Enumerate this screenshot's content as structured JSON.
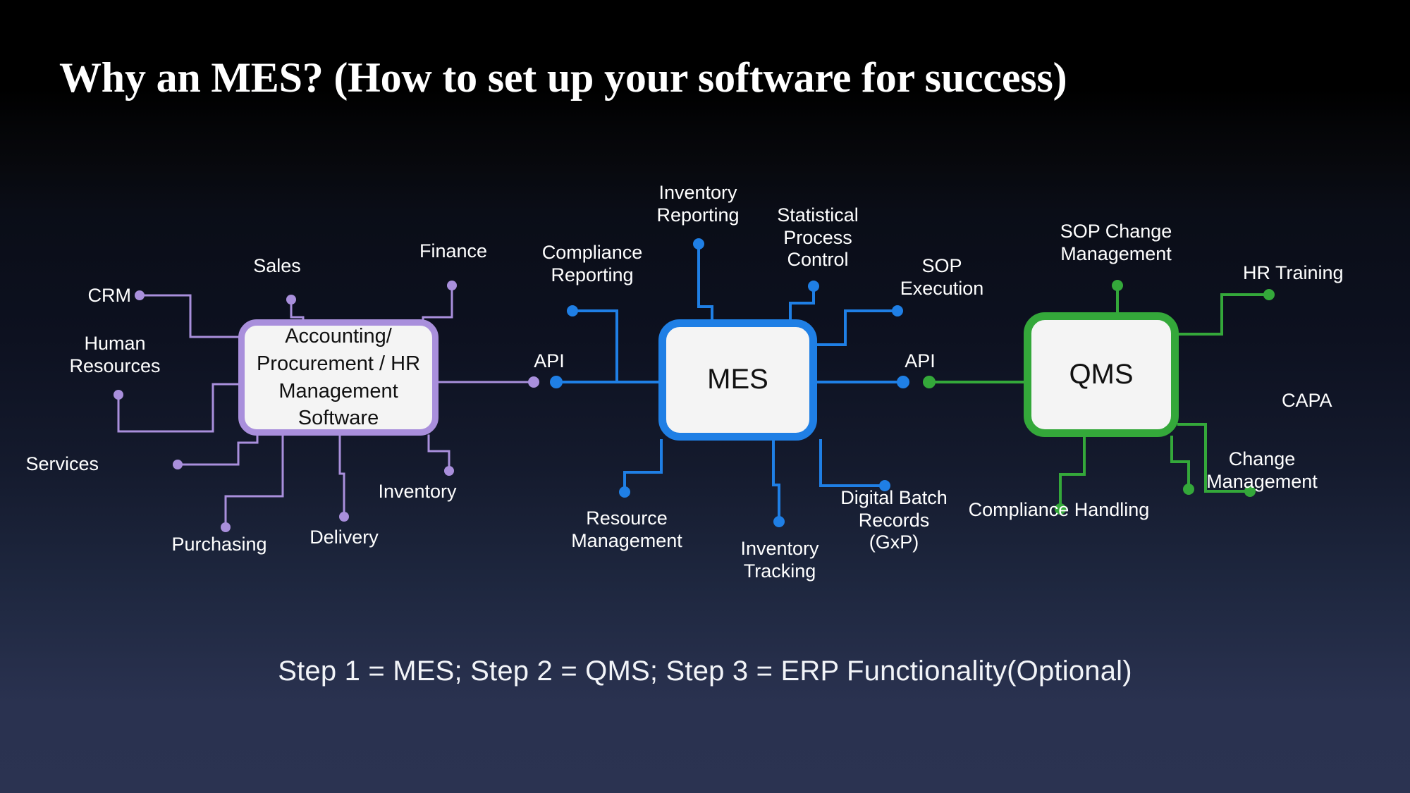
{
  "slide": {
    "title": "Why an MES? (How to set up your software for success)",
    "caption": "Step 1 = MES; Step 2 = QMS; Step 3 = ERP Functionality(Optional)"
  },
  "colors": {
    "erp_accent": "#a98fdc",
    "mes_accent": "#1f7fe5",
    "qms_accent": "#34a83a",
    "hub_fill": "#f4f4f4",
    "text": "#ffffff",
    "bg_top": "#000000",
    "bg_bottom": "#2b3351"
  },
  "clusters": {
    "erp": {
      "hub_label": "Accounting/\nProcurement /\nHR Management\nSoftware",
      "nodes": [
        {
          "label": "CRM"
        },
        {
          "label": "Sales"
        },
        {
          "label": "Finance"
        },
        {
          "label": "Human\nResources"
        },
        {
          "label": "Services"
        },
        {
          "label": "Purchasing"
        },
        {
          "label": "Delivery"
        },
        {
          "label": "Inventory"
        }
      ]
    },
    "mes": {
      "hub_label": "MES",
      "nodes": [
        {
          "label": "Compliance\nReporting"
        },
        {
          "label": "Inventory\nReporting"
        },
        {
          "label": "Statistical\nProcess\nControl"
        },
        {
          "label": "SOP\nExecution"
        },
        {
          "label": "Resource\nManagement"
        },
        {
          "label": "Inventory\nTracking"
        },
        {
          "label": "Digital Batch\nRecords\n(GxP)"
        }
      ]
    },
    "qms": {
      "hub_label": "QMS",
      "nodes": [
        {
          "label": "SOP Change\nManagement"
        },
        {
          "label": "HR Training"
        },
        {
          "label": "CAPA"
        },
        {
          "label": "Change\nManagement"
        },
        {
          "label": "Compliance Handling"
        }
      ]
    }
  },
  "links": {
    "erp_to_mes": "API",
    "mes_to_qms": "API"
  }
}
